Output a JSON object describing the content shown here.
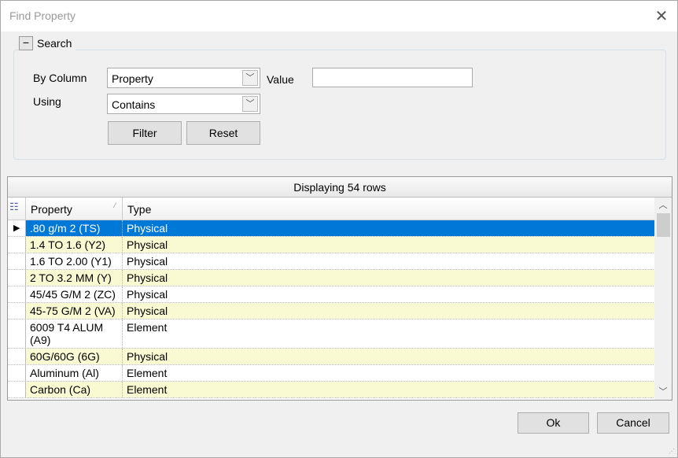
{
  "window": {
    "title": "Find Property",
    "close_icon": "close-icon"
  },
  "search": {
    "legend": "Search",
    "by_column_label": "By Column",
    "by_column_value": "Property",
    "value_label": "Value",
    "value": "",
    "using_label": "Using",
    "using_value": "Contains",
    "filter_label": "Filter",
    "reset_label": "Reset"
  },
  "grid": {
    "caption": "Displaying 54 rows",
    "columns": [
      "Property",
      "Type"
    ],
    "rows": [
      {
        "property": ".80 g/m 2 (TS)",
        "type": "Physical",
        "selected": true
      },
      {
        "property": "1.4 TO 1.6 (Y2)",
        "type": "Physical"
      },
      {
        "property": "1.6 TO 2.00 (Y1)",
        "type": "Physical"
      },
      {
        "property": "2 TO 3.2 MM (Y)",
        "type": "Physical"
      },
      {
        "property": "45/45 G/M 2 (ZC)",
        "type": "Physical"
      },
      {
        "property": "45-75 G/M 2 (VA)",
        "type": "Physical"
      },
      {
        "property": "6009 T4 ALUM (A9)",
        "type": "Element"
      },
      {
        "property": "60G/60G (6G)",
        "type": "Physical"
      },
      {
        "property": "Aluminum (Al)",
        "type": "Element"
      },
      {
        "property": "Carbon (Ca)",
        "type": "Element"
      }
    ],
    "colors": {
      "selected": "#0078d7",
      "alternate": "#fafad2"
    }
  },
  "footer": {
    "ok_label": "Ok",
    "cancel_label": "Cancel"
  }
}
